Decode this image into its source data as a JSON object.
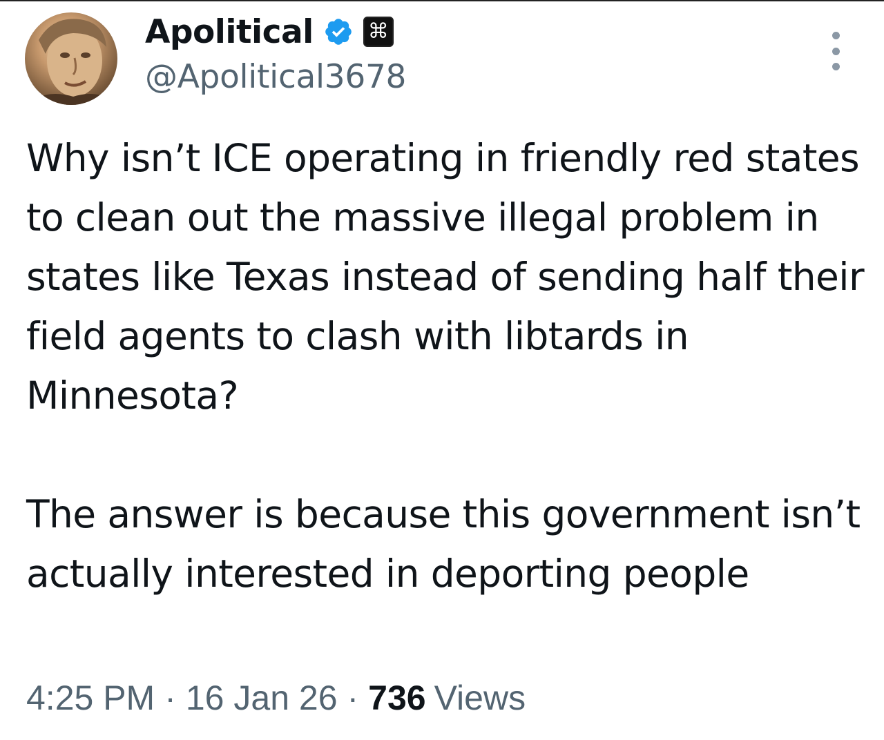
{
  "author": {
    "display_name": "Apolitical",
    "handle": "@Apolitical3678",
    "avatar_icon": "portrait-avatar",
    "verified_icon": "verified-badge-icon",
    "affiliate_icon": "command-key-icon",
    "affiliate_glyph": "⌘"
  },
  "tweet": {
    "paragraph_1": "Why isn’t ICE operating in friendly red states to clean out the massive illegal problem in states like Texas instead of sending half their field agents to clash with libtards in Minnesota?",
    "paragraph_2": "The answer is because this government isn’t actually interested in deporting people"
  },
  "meta": {
    "time": "4:25 PM",
    "separator": "·",
    "date": "16 Jan 26",
    "views_count": "736",
    "views_label": "Views"
  },
  "colors": {
    "verified": "#1d9bf0",
    "secondary_text": "#536471",
    "primary_text": "#0f1419"
  }
}
